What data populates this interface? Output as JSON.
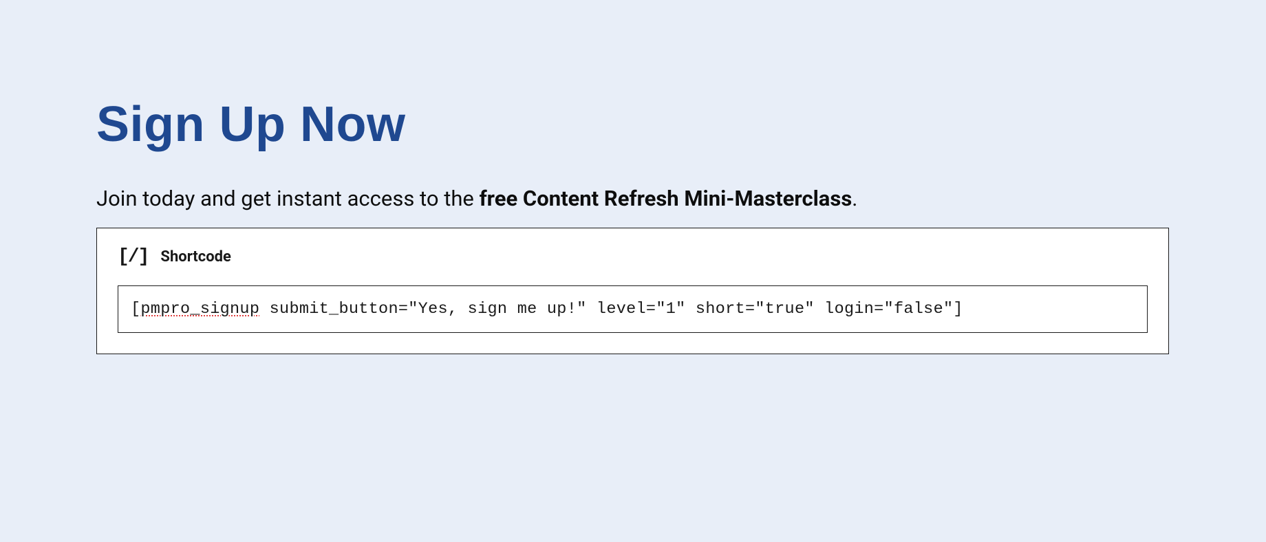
{
  "heading": "Sign Up Now",
  "subtitle": {
    "prefix": "Join today and get instant access to the ",
    "bold": "free Content Refresh Mini-Masterclass",
    "suffix": "."
  },
  "block": {
    "icon_text": "[/]",
    "label": "Shortcode",
    "input": {
      "open_bracket": "[",
      "spellcheck_word": "pmpro_signup",
      "rest": " submit_button=\"Yes, sign me up!\" level=\"1\" short=\"true\" login=\"false\"]"
    }
  }
}
